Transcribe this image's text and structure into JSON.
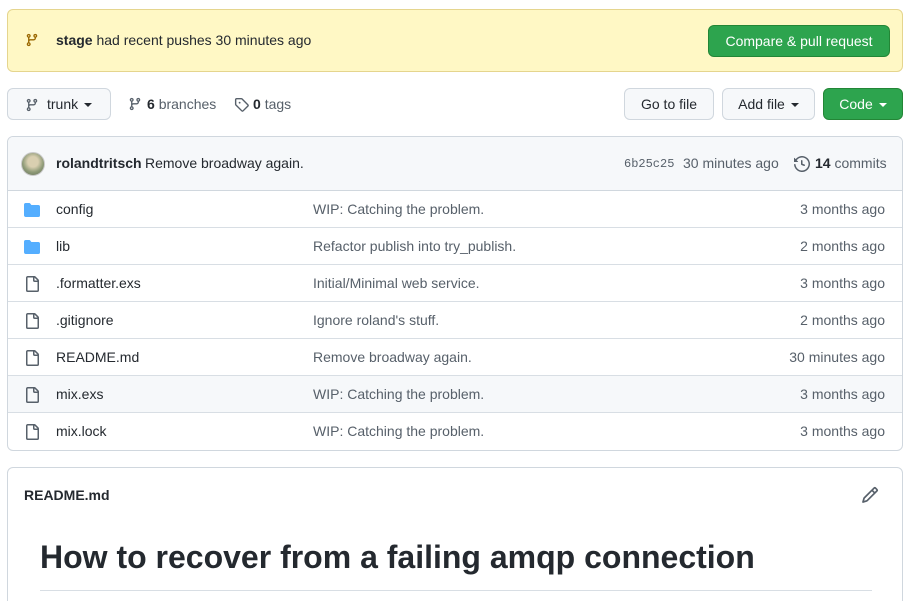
{
  "banner": {
    "branch": "stage",
    "message": "had recent pushes 30 minutes ago",
    "compare_label": "Compare & pull request"
  },
  "toolbar": {
    "branch_label": "trunk",
    "branches_count": "6",
    "branches_label": "branches",
    "tags_count": "0",
    "tags_label": "tags",
    "goto_label": "Go to file",
    "addfile_label": "Add file",
    "code_label": "Code"
  },
  "latest_commit": {
    "author": "rolandtritsch",
    "message": "Remove broadway again.",
    "sha": "6b25c25",
    "time": "30 minutes ago",
    "commits_count": "14",
    "commits_label": "commits"
  },
  "files": [
    {
      "type": "folder",
      "name": "config",
      "message": "WIP: Catching the problem.",
      "age": "3 months ago"
    },
    {
      "type": "folder",
      "name": "lib",
      "message": "Refactor publish into try_publish.",
      "age": "2 months ago"
    },
    {
      "type": "file",
      "name": ".formatter.exs",
      "message": "Initial/Minimal web service.",
      "age": "3 months ago"
    },
    {
      "type": "file",
      "name": ".gitignore",
      "message": "Ignore roland's stuff.",
      "age": "2 months ago"
    },
    {
      "type": "file",
      "name": "README.md",
      "message": "Remove broadway again.",
      "age": "30 minutes ago"
    },
    {
      "type": "file",
      "name": "mix.exs",
      "message": "WIP: Catching the problem.",
      "age": "3 months ago"
    },
    {
      "type": "file",
      "name": "mix.lock",
      "message": "WIP: Catching the problem.",
      "age": "3 months ago"
    }
  ],
  "readme": {
    "filename": "README.md",
    "heading": "How to recover from a failing amqp connection"
  },
  "colors": {
    "banner_bg": "#fff8c5",
    "primary_green": "#2da44e",
    "folder_blue": "#54aeff",
    "muted_text": "#57606a"
  },
  "icons": {
    "branch": "git-branch-icon",
    "tag": "tag-icon",
    "history": "history-icon",
    "folder": "folder-icon",
    "file": "file-icon",
    "edit": "pencil-icon"
  }
}
